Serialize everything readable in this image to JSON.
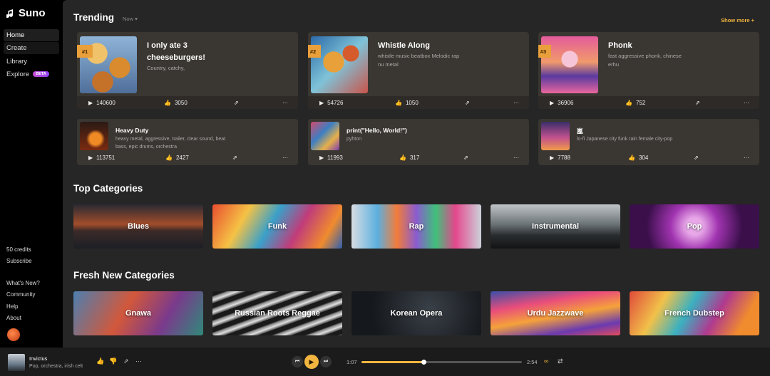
{
  "brand": {
    "name": "Suno"
  },
  "sidebar": {
    "nav": [
      {
        "label": "Home",
        "active": true
      },
      {
        "label": "Create"
      },
      {
        "label": "Library"
      },
      {
        "label": "Explore",
        "badge": "BETA"
      }
    ],
    "credits": "50 credits",
    "subscribe": "Subscribe",
    "links": [
      "What's New?",
      "Community",
      "Help",
      "About"
    ]
  },
  "trending": {
    "title": "Trending",
    "filter": "Now",
    "show_more": "Show more +",
    "top": [
      {
        "rank": "#1",
        "title_line1": "I only ate 3",
        "title_line2": "cheeseburgers!",
        "tags": "Country, catchy,",
        "plays": "140600",
        "likes": "3050"
      },
      {
        "rank": "#2",
        "title_line1": "Whistle Along",
        "title_line2": "",
        "tags": "whistle music beatbox Melodic rap",
        "tags2": "nu metal",
        "plays": "54726",
        "likes": "1050"
      },
      {
        "rank": "#3",
        "title_line1": "Phonk",
        "title_line2": "",
        "tags": "fast aggressive phonk, chinese",
        "tags2": "erhu",
        "plays": "36906",
        "likes": "752"
      }
    ],
    "small": [
      {
        "title": "Heavy Duty",
        "tags": "heavy metal, aggressive, trailer, clear sound, beat",
        "tags2": "bass, epic drums, orchestra",
        "plays": "113751",
        "likes": "2427"
      },
      {
        "title": "print(\"Hello, World!\")",
        "tags": "pyhton",
        "tags2": "",
        "plays": "11993",
        "likes": "317"
      },
      {
        "title": "嵐",
        "tags": "lo-fi Japanese city funk rain female city-pop",
        "tags2": "",
        "plays": "7788",
        "likes": "304"
      }
    ]
  },
  "top_categories": {
    "title": "Top Categories",
    "items": [
      "Blues",
      "Funk",
      "Rap",
      "Instrumental",
      "Pop"
    ]
  },
  "fresh_categories": {
    "title": "Fresh New Categories",
    "items": [
      "Gnawa",
      "Russian Roots Reggae",
      "Korean Opera",
      "Urdu Jazzwave",
      "French Dubstep"
    ]
  },
  "player": {
    "title": "Invictus",
    "tags": "Pop, orchestra, irish celt",
    "elapsed": "1:07",
    "duration": "2:54",
    "progress": 0.39
  },
  "colors": {
    "accent": "#e99f3a",
    "bg": "#262626",
    "card": "#3a3631"
  }
}
